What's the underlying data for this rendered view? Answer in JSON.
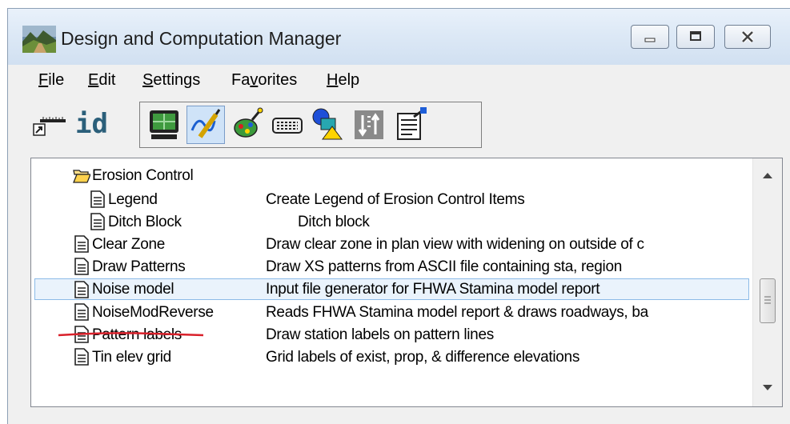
{
  "window": {
    "title": "Design and Computation Manager",
    "icon": "dc-manager-landscape-icon",
    "controls": {
      "minimize": "minimize-icon",
      "restore": "restore-icon",
      "close": "close-icon"
    }
  },
  "menu": [
    "File",
    "Edit",
    "Settings",
    "Favorites",
    "Help"
  ],
  "menu_mnemonics": [
    "F",
    "E",
    "S",
    "v",
    "H"
  ],
  "toolbar": {
    "id_label": "id",
    "icons": [
      "measure-ruler-icon",
      "id-icon",
      "monitor-icon",
      "draw-line-icon",
      "palette-icon",
      "keyboard-icon",
      "shapes-icon",
      "sort-icon",
      "clipboard-icon"
    ]
  },
  "list": {
    "rows": [
      {
        "name": "Erosion Control",
        "desc": "",
        "type": "folder"
      },
      {
        "name": "Legend",
        "desc": "Create Legend of Erosion Control Items",
        "type": "item"
      },
      {
        "name": "Ditch Block",
        "desc": "Ditch block",
        "type": "item"
      },
      {
        "name": "Clear Zone",
        "desc": "Draw clear zone in plan view with widening on outside of c",
        "type": "item"
      },
      {
        "name": "Draw Patterns",
        "desc": "Draw XS patterns from ASCII file containing sta, region",
        "type": "item"
      },
      {
        "name": "Noise model",
        "desc": "Input file generator for FHWA Stamina model report",
        "type": "item",
        "selected": true
      },
      {
        "name": "NoiseModReverse",
        "desc": "Reads FHWA Stamina model report & draws roadways, ba",
        "type": "item"
      },
      {
        "name": "Pattern labels",
        "desc": "Draw station labels on pattern lines",
        "type": "item"
      },
      {
        "name": "Tin elev grid",
        "desc": "Grid labels of exist, prop, & difference elevations",
        "type": "item"
      }
    ]
  },
  "colors": {
    "selection_bg": "#eaf3fc",
    "selection_border": "#8cbbe7",
    "annotation_red": "#d9202a"
  }
}
